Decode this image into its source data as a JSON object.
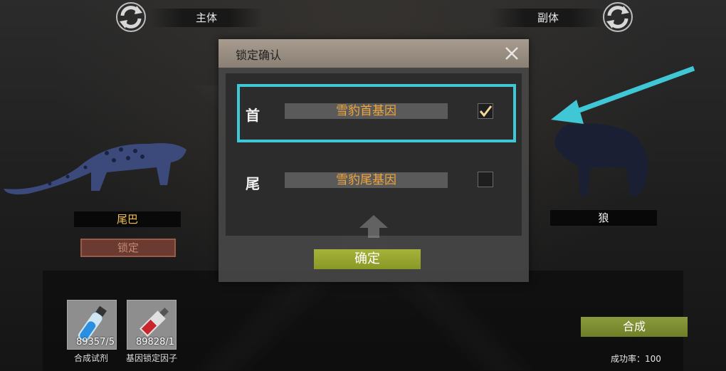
{
  "header": {
    "main_label": "主体",
    "sub_label": "副体"
  },
  "left_animal": {
    "name": "尾巴",
    "lock_label": "锁定"
  },
  "right_animal": {
    "name": "狼"
  },
  "items": [
    {
      "label": "合成试剂",
      "count": "89357/5",
      "icon": "reagent-vial-icon"
    },
    {
      "label": "基因锁定因子",
      "count": "89828/1",
      "icon": "syringe-icon"
    }
  ],
  "combine_label": "合成",
  "success_rate": "成功率：100",
  "dialog": {
    "title": "锁定确认",
    "rows": [
      {
        "key": "首",
        "value": "雪豹首基因",
        "checked": true
      },
      {
        "key": "尾",
        "value": "雪豹尾基因",
        "checked": false
      }
    ],
    "confirm_label": "确定"
  },
  "colors": {
    "highlight": "#3fc7d6",
    "gene_text": "#f0a63a",
    "confirm_button": "#a6b23a",
    "combine_button": "#8a9a3c"
  }
}
